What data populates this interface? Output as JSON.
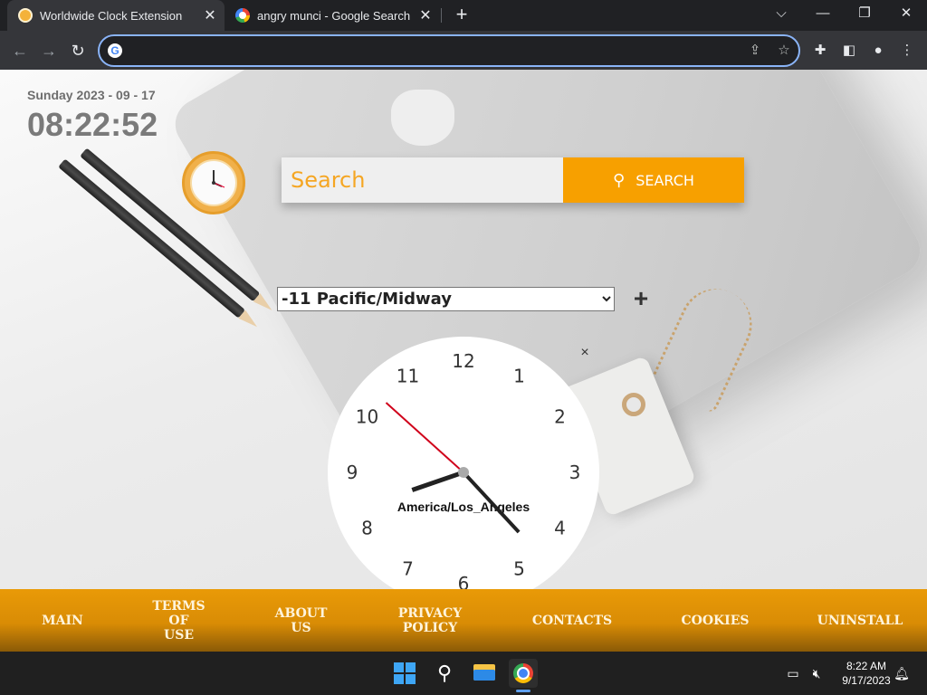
{
  "browser": {
    "tabs": [
      {
        "title": "Worldwide Clock Extension",
        "active": true,
        "icon": "clock-favicon"
      },
      {
        "title": "angry munci - Google Search",
        "active": false,
        "icon": "google-favicon"
      }
    ],
    "omnibox": {
      "value": "",
      "placeholder": ""
    },
    "window_controls": {
      "minimize": "—",
      "restore": "❐",
      "close": "✕"
    }
  },
  "page": {
    "date": "Sunday 2023 - 09 - 17",
    "time": "08:22:52",
    "search": {
      "placeholder": "Search",
      "button_label": "SEARCH"
    },
    "timezone_select": {
      "selected": "-11 Pacific/Midway"
    },
    "add_label": "+",
    "close_label": "×",
    "analog_clock": {
      "timezone_label": "America/Los_Angeles",
      "numbers": [
        "12",
        "1",
        "2",
        "3",
        "4",
        "5",
        "6",
        "7",
        "8",
        "9",
        "10",
        "11"
      ],
      "hour": 8,
      "minute": 22,
      "second": 52
    }
  },
  "footer": {
    "links": [
      {
        "lines": [
          "MAIN"
        ]
      },
      {
        "lines": [
          "TERMS",
          "OF",
          "USE"
        ]
      },
      {
        "lines": [
          "ABOUT",
          "US"
        ]
      },
      {
        "lines": [
          "PRIVACY",
          "POLICY"
        ]
      },
      {
        "lines": [
          "CONTACTS"
        ]
      },
      {
        "lines": [
          "COOKIES"
        ]
      },
      {
        "lines": [
          "UNINSTALL"
        ]
      }
    ]
  },
  "taskbar": {
    "time": "8:22 AM",
    "date": "9/17/2023"
  },
  "colors": {
    "accent": "#f7a000",
    "footer": "#e99a07",
    "second_hand": "#d0021b"
  }
}
